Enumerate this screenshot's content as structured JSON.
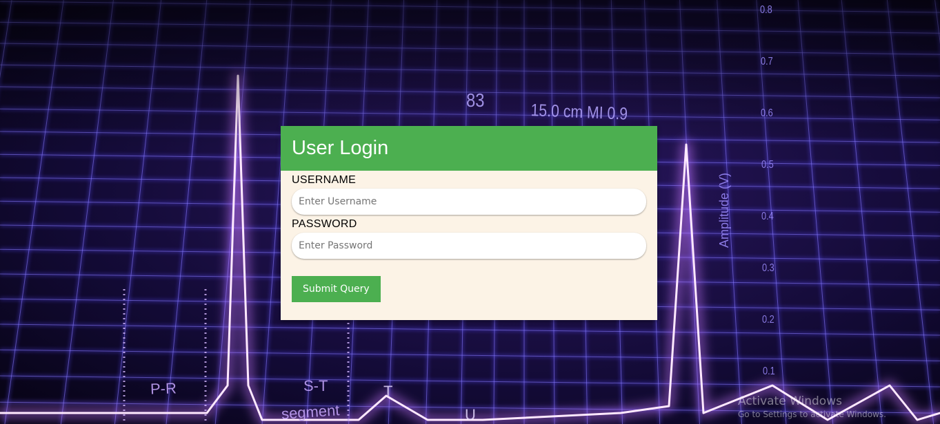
{
  "background": {
    "readout_number": "83",
    "readout_text": "15.0 cm MI 0.9",
    "axis_title": "Amplitude (V)",
    "axis_ticks": [
      "0.8",
      "0.7",
      "0.6",
      "0.5",
      "0.4",
      "0.3",
      "0.2",
      "0.1"
    ],
    "segment_labels": {
      "pr": "P-R",
      "st": "S-T",
      "segment": "segment",
      "t_wave": "T",
      "u_wave": "U"
    },
    "colors": {
      "grid": "#5a4bff",
      "glow": "#e8b8ff",
      "backdrop": "#080418"
    }
  },
  "login": {
    "title": "User Login",
    "username_label": "USERNAME",
    "username_placeholder": "Enter Username",
    "username_value": "",
    "password_label": "PASSWORD",
    "password_placeholder": "Enter Password",
    "password_value": "",
    "submit_label": "Submit Query",
    "colors": {
      "header": "#4caf50",
      "panel": "#fcf3e6",
      "button": "#4caf50"
    }
  },
  "watermark": {
    "title": "Activate Windows",
    "subtitle": "Go to Settings to activate Windows."
  }
}
